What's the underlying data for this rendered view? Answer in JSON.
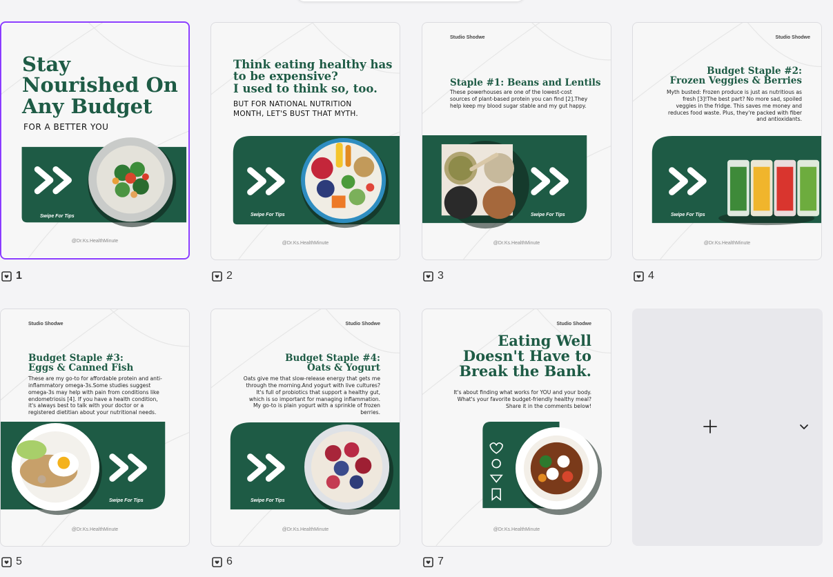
{
  "brand_name": "Studio Shodwe",
  "handle": "@Dr.Ks.HealthMinute",
  "swipe_text": "Swipe For Tips",
  "colors": {
    "green": "#1e5b45",
    "selected": "#8b3dff"
  },
  "pages": [
    {
      "number": "1",
      "title_lines": [
        "Stay",
        "Nourished On",
        "Any Budget"
      ],
      "subtitle": "FOR A BETTER YOU"
    },
    {
      "number": "2",
      "title_lines": [
        "Think eating healthy has",
        "to be expensive?",
        "I used to think so, too."
      ],
      "caps": "BUT FOR NATIONAL NUTRITION MONTH, LET'S BUST THAT MYTH."
    },
    {
      "number": "3",
      "title": "Staple #1: Beans and Lentils",
      "body": "These powerhouses are one of the lowest-cost sources of plant-based protein you can find [2].They help keep my blood sugar stable and my gut happy."
    },
    {
      "number": "4",
      "title_lines": [
        "Budget Staple #2:",
        "Frozen Veggies & Berries"
      ],
      "body": "Myth busted: Frozen produce is just as nutritious as fresh [3]!The best part? No more sad, spoiled veggies in the fridge. This saves me money and reduces food waste. Plus, they're packed with fiber and antioxidants."
    },
    {
      "number": "5",
      "title_lines": [
        "Budget Staple #3:",
        "Eggs & Canned Fish"
      ],
      "body": "These are my go-to for affordable protein and anti-inflammatory omega-3s.Some studies suggest omega-3s may help with pain from conditions like endometriosis [4]. If you have a health condition, it's always best to talk with your doctor or a registered dietitian about your nutritional needs."
    },
    {
      "number": "6",
      "title_lines": [
        "Budget Staple #4:",
        "Oats & Yogurt"
      ],
      "body": "Oats give me that slow-release energy that gets me through the morning.And yogurt with live cultures? It's full of probiotics that support a healthy gut, which is so important for managing inflammation. My go-to is plain yogurt with a sprinkle of frozen berries."
    },
    {
      "number": "7",
      "title_lines": [
        "Eating Well",
        "Doesn't Have to",
        "Break the Bank."
      ],
      "body": "It's about finding what works for YOU and your body. What's your favorite budget-friendly healthy meal? Share it in the comments below!"
    }
  ]
}
